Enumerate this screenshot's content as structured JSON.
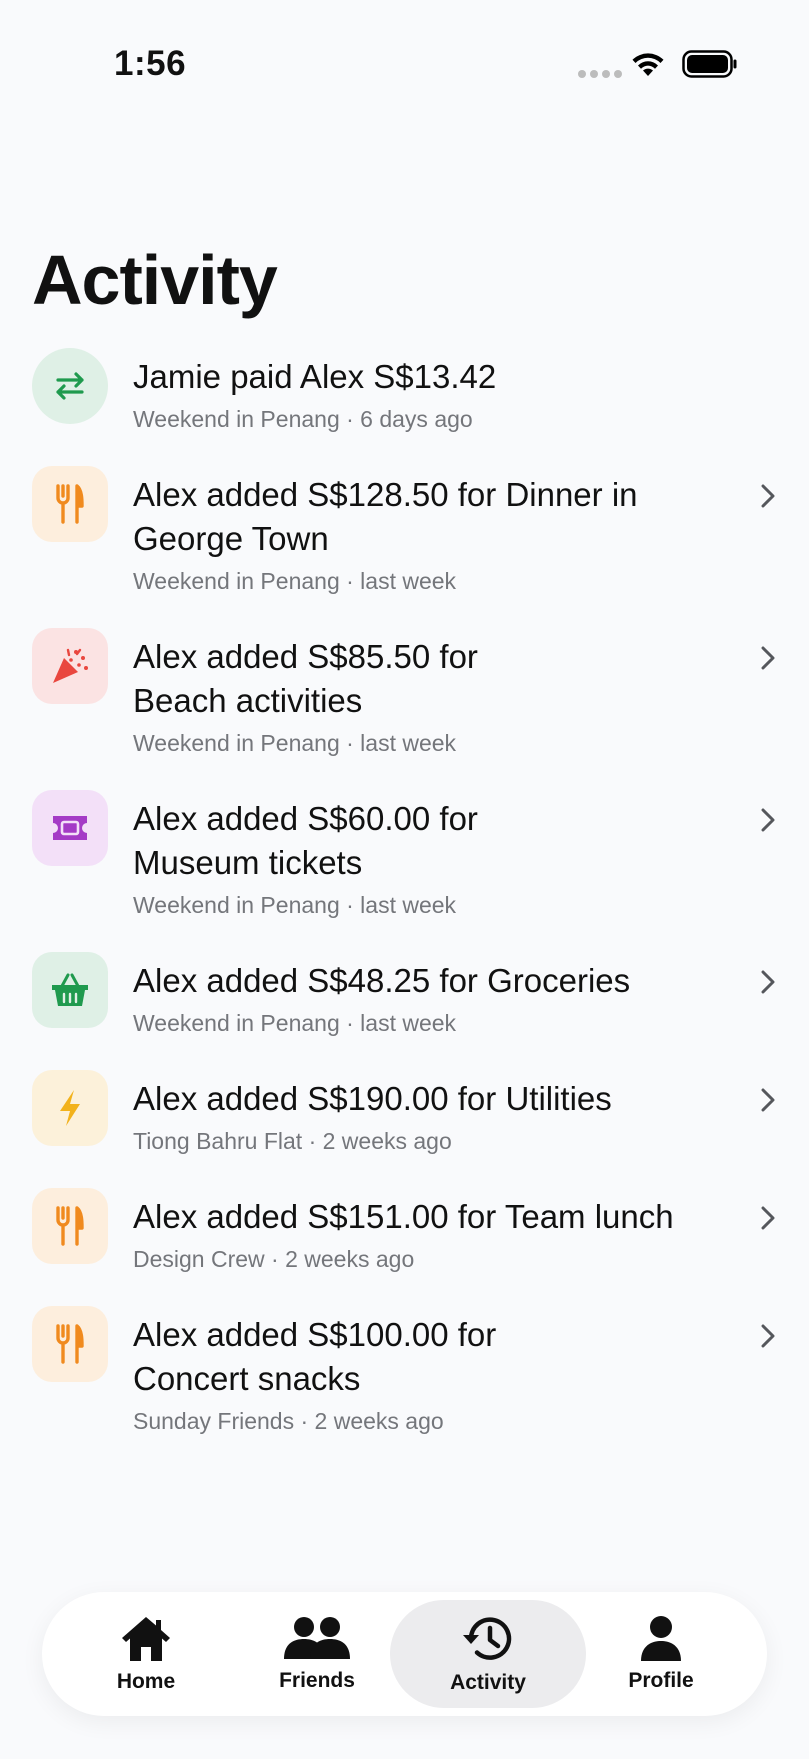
{
  "status_bar": {
    "time": "1:56"
  },
  "header": {
    "title": "Activity"
  },
  "activities": [
    {
      "title": "Jamie paid Alex S$13.42",
      "subtitle": "Weekend in Penang · 6 days ago",
      "icon": "transfer-arrows-icon",
      "icon_bg": "#dff0e6",
      "icon_color": "#1f9a4e"
    },
    {
      "title": "Alex added S$128.50 for Dinner in\nGeorge Town",
      "subtitle": "Weekend in Penang · last week",
      "icon": "fork-knife-icon",
      "icon_bg": "#fdeedd",
      "icon_color": "#f08a1e"
    },
    {
      "title": "Alex added S$85.50 for\nBeach activities",
      "subtitle": "Weekend in Penang · last week",
      "icon": "party-popper-icon",
      "icon_bg": "#fbe3e3",
      "icon_color": "#e9473f"
    },
    {
      "title": "Alex added S$60.00 for\nMuseum tickets",
      "subtitle": "Weekend in Penang · last week",
      "icon": "ticket-icon",
      "icon_bg": "#f3e0f8",
      "icon_color": "#a43bc6"
    },
    {
      "title": "Alex added S$48.25 for Groceries",
      "subtitle": "Weekend in Penang · last week",
      "icon": "basket-icon",
      "icon_bg": "#dff0e6",
      "icon_color": "#1f9a4e"
    },
    {
      "title": "Alex added S$190.00 for Utilities",
      "subtitle": "Tiong Bahru Flat · 2 weeks ago",
      "icon": "lightning-icon",
      "icon_bg": "#fcf1da",
      "icon_color": "#f2b21b"
    },
    {
      "title": "Alex added S$151.00 for Team lunch",
      "subtitle": "Design Crew · 2 weeks ago",
      "icon": "fork-knife-icon",
      "icon_bg": "#fdeedd",
      "icon_color": "#f08a1e"
    },
    {
      "title": "Alex added S$100.00 for\nConcert snacks",
      "subtitle": "Sunday Friends · 2 weeks ago",
      "icon": "fork-knife-icon",
      "icon_bg": "#fdeedd",
      "icon_color": "#f08a1e"
    }
  ],
  "tabbar": {
    "items": [
      {
        "label": "Home",
        "icon": "house-icon",
        "active": false
      },
      {
        "label": "Friends",
        "icon": "people-icon",
        "active": false
      },
      {
        "label": "Activity",
        "icon": "history-clock-icon",
        "active": true
      },
      {
        "label": "Profile",
        "icon": "person-icon",
        "active": false
      }
    ]
  }
}
